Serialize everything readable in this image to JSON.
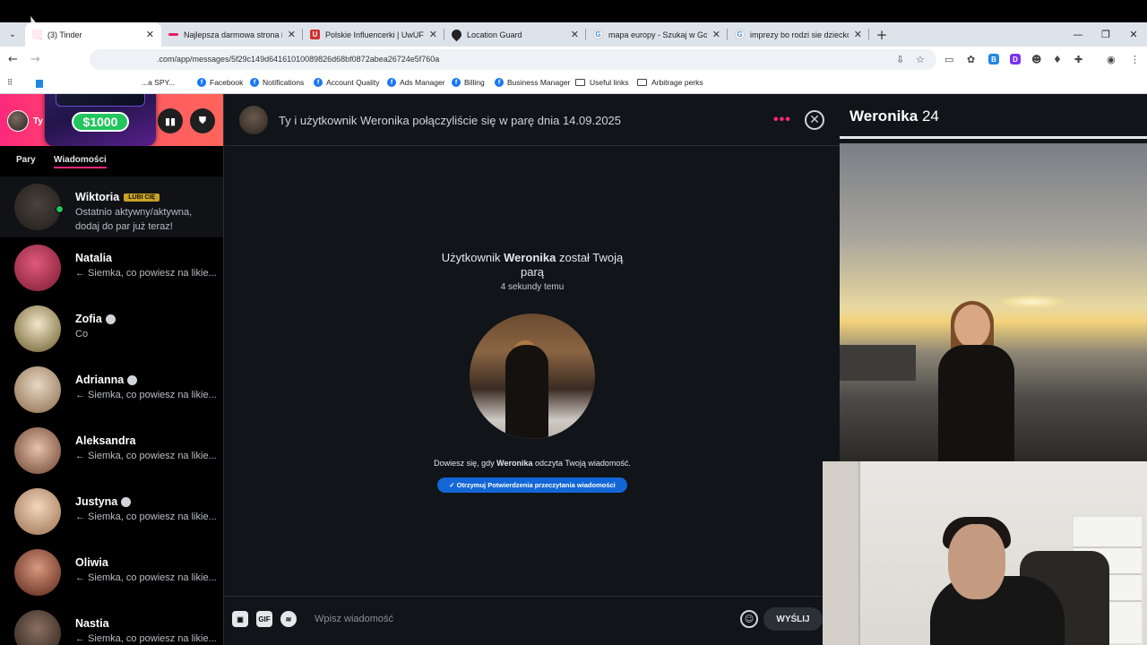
{
  "browser": {
    "tabs": [
      {
        "title": "(3) Tinder",
        "favicon_color": "#fd267d",
        "active": true
      },
      {
        "title": "Najlepsza darmowa strona i ap",
        "favicon_color": "#e91e63",
        "active": false
      },
      {
        "title": "Polskie Influencerki | UwUFUFU",
        "favicon_color": "#d32f2f",
        "favicon_glyph": "U",
        "active": false
      },
      {
        "title": "Location Guard",
        "favicon_color": "#222222",
        "active": false
      },
      {
        "title": "mapa europy - Szukaj w Google",
        "favicon_color": "#4285f4",
        "favicon_glyph": "G",
        "active": false
      },
      {
        "title": "imprezy bo rodzi sie dziecko - S",
        "favicon_color": "#4285f4",
        "favicon_glyph": "G",
        "active": false
      }
    ],
    "url": ".com/app/messages/5f29c149d64161010089826d68bf0872abea26724e5f760a",
    "bookmarks": [
      {
        "label": "...a SPY...",
        "icon": "globe-icon"
      },
      {
        "label": "Facebook",
        "icon": "facebook-icon"
      },
      {
        "label": "Notifications",
        "icon": "facebook-icon"
      },
      {
        "label": "Account Quality",
        "icon": "facebook-icon"
      },
      {
        "label": "Ads Manager",
        "icon": "facebook-icon"
      },
      {
        "label": "Billing",
        "icon": "facebook-icon"
      },
      {
        "label": "Business Manager",
        "icon": "facebook-icon"
      },
      {
        "label": "Useful links",
        "icon": "folder-icon"
      },
      {
        "label": "Arbitrage perks",
        "icon": "folder-icon"
      }
    ]
  },
  "promo": {
    "amount": "$1000"
  },
  "sidebar": {
    "me_label": "Ty",
    "tabs": {
      "matches": "Pary",
      "messages": "Wiadomości"
    },
    "conversations": [
      {
        "name": "Wiktoria",
        "badge": "LUBI CIĘ",
        "preview": "Ostatnio aktywny/aktywna, dodaj do par już teraz!",
        "online": true,
        "avatar": "#3a3530"
      },
      {
        "name": "Natalia",
        "preview": "← Siemka, co powiesz na likie...",
        "avatar": "#c0305a"
      },
      {
        "name": "Zofia",
        "verified": true,
        "preview": "Co",
        "avatar": "#8a7a4a"
      },
      {
        "name": "Adrianna",
        "verified": true,
        "preview": "← Siemka, co powiesz na likie...",
        "avatar": "#b89a78"
      },
      {
        "name": "Aleksandra",
        "preview": "← Siemka, co powiesz na likie...",
        "avatar": "#9a7060"
      },
      {
        "name": "Justyna",
        "verified": true,
        "preview": "← Siemka, co powiesz na likie...",
        "avatar": "#c8a88a"
      },
      {
        "name": "Oliwia",
        "preview": "← Siemka, co powiesz na likie...",
        "avatar": "#7a3a2a"
      },
      {
        "name": "Nastia",
        "preview": "← Siemka, co powiesz na likie...",
        "avatar": "#4a3a30"
      }
    ]
  },
  "chat": {
    "header": "Ty i użytkownik Weronika połączyliście się w parę dnia 14.09.2025",
    "match_prefix": "Użytkownik ",
    "match_name": "Weronika",
    "match_suffix": " został Twoją",
    "match_line2": "parą",
    "match_time": "4 sekundy temu",
    "read_prefix": "Dowiesz się, gdy ",
    "read_name": "Weronika",
    "read_suffix": " odczyta Twoją wiadomość.",
    "read_button": "✓ Otrzymuj Potwierdzenia przeczytania wiadomości",
    "input_placeholder": "Wpisz wiadomość",
    "send_label": "WYŚLIJ",
    "gif_label": "GIF"
  },
  "profile": {
    "name": "Weronika",
    "age": "24"
  },
  "colors": {
    "brand": "#fd267d",
    "read_button": "#1366d6"
  }
}
